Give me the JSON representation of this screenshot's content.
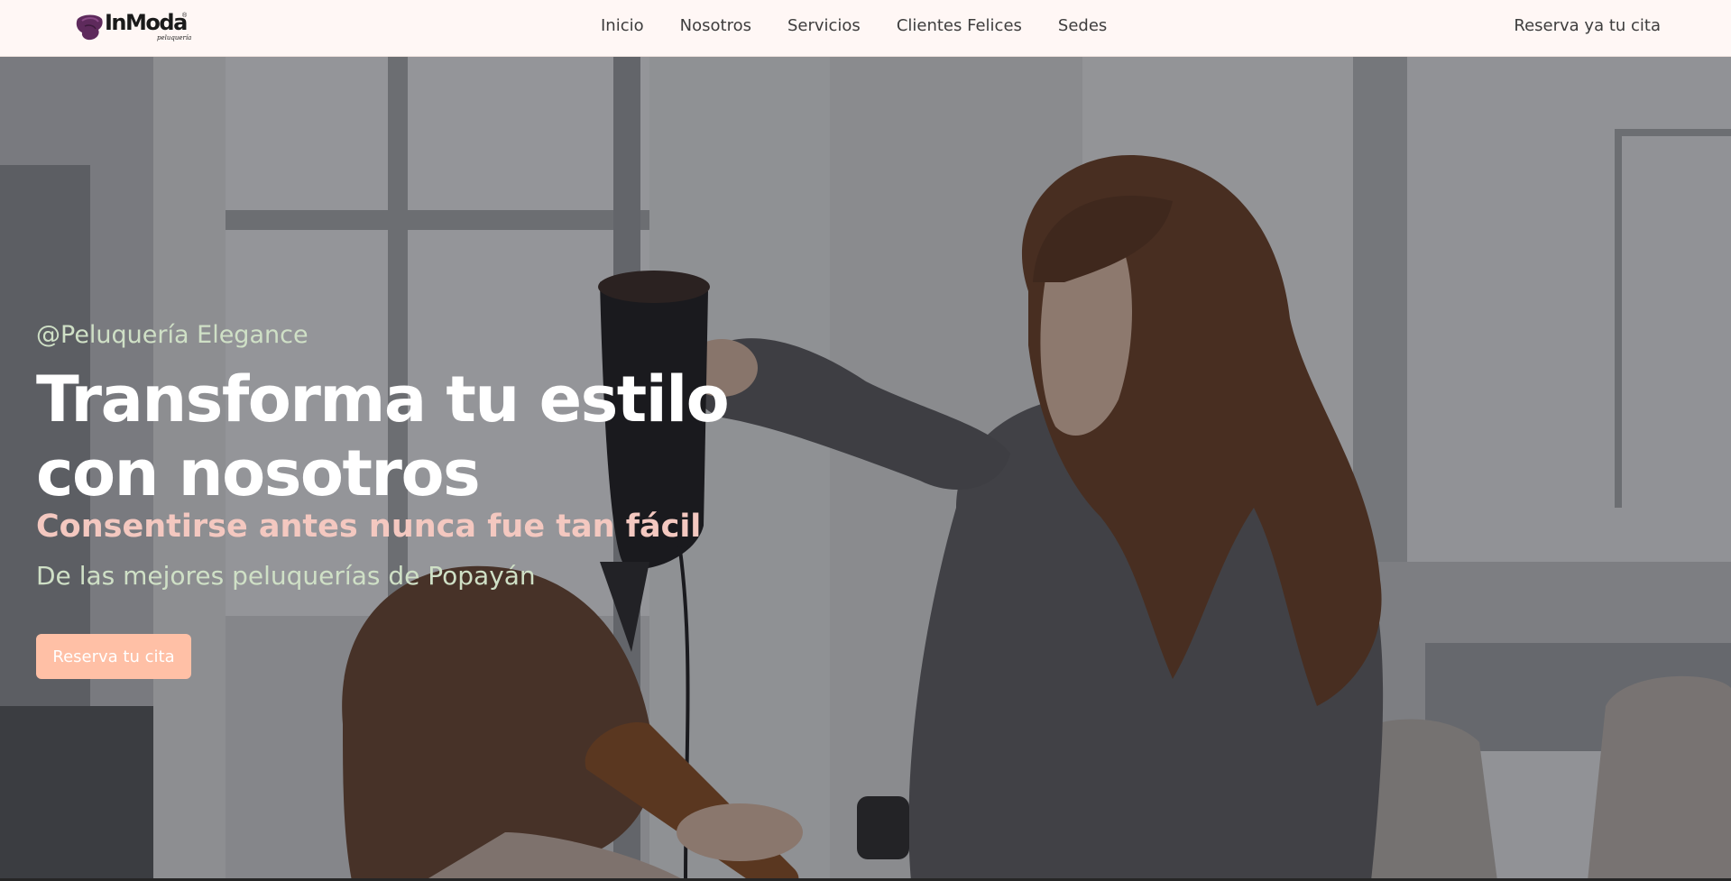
{
  "brand": {
    "name": "InModa",
    "registered": "®",
    "sub": "peluquería",
    "mark_color": "#5e2a5c"
  },
  "nav": {
    "links": [
      {
        "label": "Inicio"
      },
      {
        "label": "Nosotros"
      },
      {
        "label": "Servicios"
      },
      {
        "label": "Clientes Felices"
      },
      {
        "label": "Sedes"
      }
    ],
    "cta_label": "Reserva ya tu cita"
  },
  "hero": {
    "tagline": "@Peluquería Elegance",
    "title_line1": "Transforma tu estilo",
    "title_line2": "con nosotros",
    "subtitle": "Consentirse antes nunca fue tan fácil",
    "caption": "De las mejores peluquerías de Popayán",
    "button_label": "Reserva tu cita",
    "photo_icon": "hair-salon-stylist-photo"
  },
  "colors": {
    "navbar_bg": "#fff7f5",
    "accent_peach": "#ffc0a6",
    "subtitle_pink": "#f4c8c0",
    "caption_green": "#cfe0c6",
    "title_white": "#ffffff"
  }
}
